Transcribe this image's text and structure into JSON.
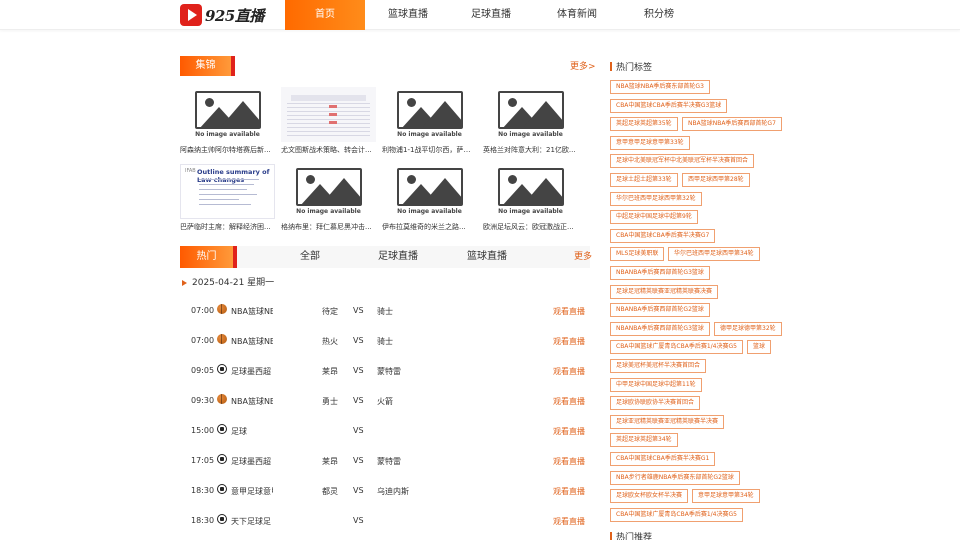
{
  "header": {
    "logo_text": "925直播",
    "nav": [
      {
        "label": "首页",
        "active": true
      },
      {
        "label": "篮球直播",
        "active": false
      },
      {
        "label": "足球直播",
        "active": false
      },
      {
        "label": "体育新闻",
        "active": false
      },
      {
        "label": "积分榜",
        "active": false
      }
    ]
  },
  "gallery": {
    "title": "集锦",
    "more": "更多>",
    "placeholder_text": "No image available",
    "items": [
      {
        "caption": "阿森纳主帅阿尔特塔赛后新...",
        "image": "placeholder"
      },
      {
        "caption": "尤文图斯战术策略、转会计...",
        "image": "table"
      },
      {
        "caption": "利物浦1-1战平切尔西，萨拉...",
        "image": "placeholder"
      },
      {
        "caption": "英格兰对阵意大利：21亿欧...",
        "image": "placeholder"
      },
      {
        "caption": "巴萨临时主席：解释经济困...",
        "image": "document"
      },
      {
        "caption": "格纳布里：拜仁慕尼黑冲击...",
        "image": "placeholder"
      },
      {
        "caption": "伊布拉莫维奇的米兰之路...",
        "image": "placeholder"
      },
      {
        "caption": "欧洲足坛风云：欧冠激战正...",
        "image": "placeholder"
      }
    ],
    "doc_image": {
      "tag": "IFAB",
      "title": "Outline summary of Law changes"
    }
  },
  "schedule": {
    "tabs": [
      {
        "label": "热门",
        "active": true
      },
      {
        "label": "全部",
        "active": false
      },
      {
        "label": "足球直播",
        "active": false
      },
      {
        "label": "篮球直播",
        "active": false
      }
    ],
    "more": "更多",
    "date": "2025-04-21 星期一",
    "watch_label": "观看直播",
    "vs_label": "VS",
    "matches": [
      {
        "time": "07:00",
        "sport": "basketball",
        "league": "NBA篮球NBA",
        "home": "待定",
        "away": "骑士"
      },
      {
        "time": "07:00",
        "sport": "basketball",
        "league": "NBA篮球NBA",
        "home": "热火",
        "away": "骑士"
      },
      {
        "time": "09:05",
        "sport": "soccer",
        "league": "足球墨西超",
        "home": "莱昂",
        "away": "蒙特雷"
      },
      {
        "time": "09:30",
        "sport": "basketball",
        "league": "NBA篮球NBA",
        "home": "勇士",
        "away": "火箭"
      },
      {
        "time": "15:00",
        "sport": "soccer",
        "league": "足球",
        "home": "",
        "away": ""
      },
      {
        "time": "17:05",
        "sport": "soccer",
        "league": "足球墨西超",
        "home": "莱昂",
        "away": "蒙特雷"
      },
      {
        "time": "18:30",
        "sport": "soccer",
        "league": "意甲足球意甲",
        "home": "都灵",
        "away": "乌迪内斯"
      },
      {
        "time": "18:30",
        "sport": "soccer",
        "league": "天下足球足",
        "home": "",
        "away": ""
      }
    ]
  },
  "sidebar": {
    "hot_tags_title": "热门标签",
    "hot_recommend_title": "热门推荐",
    "tag_rows": [
      [
        "NBA篮球NBA季后赛东部首轮G3"
      ],
      [
        "CBA中国篮球CBA季后赛半决赛G3篮球"
      ],
      [
        "英超足球英超第35轮",
        "NBA篮球NBA季后赛西部首轮G7"
      ],
      [
        "意甲意甲足球意甲第33轮"
      ],
      [
        "足球中北美联冠军杯中北美联冠军杯半决赛首回合"
      ],
      [
        "足球土超土超第33轮",
        "西甲足球西甲第28轮"
      ],
      [
        "华尔巴班西甲足球西甲第32轮"
      ],
      [
        "中超足球中国足球中超第9轮"
      ],
      [
        "CBA中国篮球CBA季后赛半决赛G7"
      ],
      [
        "MLS足球美职联",
        "华尔巴班西甲足球西甲第34轮"
      ],
      [
        "NBANBA季后赛西部首轮G3篮球"
      ],
      [
        "足球足冠精英联赛亚冠精英联赛决赛"
      ],
      [
        "NBANBA季后赛西部首轮G2篮球"
      ],
      [
        "NBANBA季后赛西部首轮G3篮球",
        "德甲足球德甲第32轮"
      ],
      [
        "CBA中国篮球广厦青岛CBA季后赛1/4决赛G5",
        "篮球"
      ],
      [
        "足球美冠杯美冠杯半决赛首回合"
      ],
      [
        "中甲足球中国足球中超第11轮"
      ],
      [
        "足球欧协联欧协半决赛首回合"
      ],
      [
        "足球亚冠精英联赛亚冠精英联赛半决赛"
      ],
      [
        "英超足球英超第34轮"
      ],
      [
        "CBA中国篮球CBA季后赛半决赛G1"
      ],
      [
        "NBA步行者雄鹿NBA季后赛东部首轮G2篮球"
      ],
      [
        "足球欧女杯欧女杯半决赛",
        "意甲足球意甲第34轮"
      ],
      [
        "CBA中国篮球广厦青岛CBA季后赛1/4决赛G5"
      ]
    ]
  }
}
